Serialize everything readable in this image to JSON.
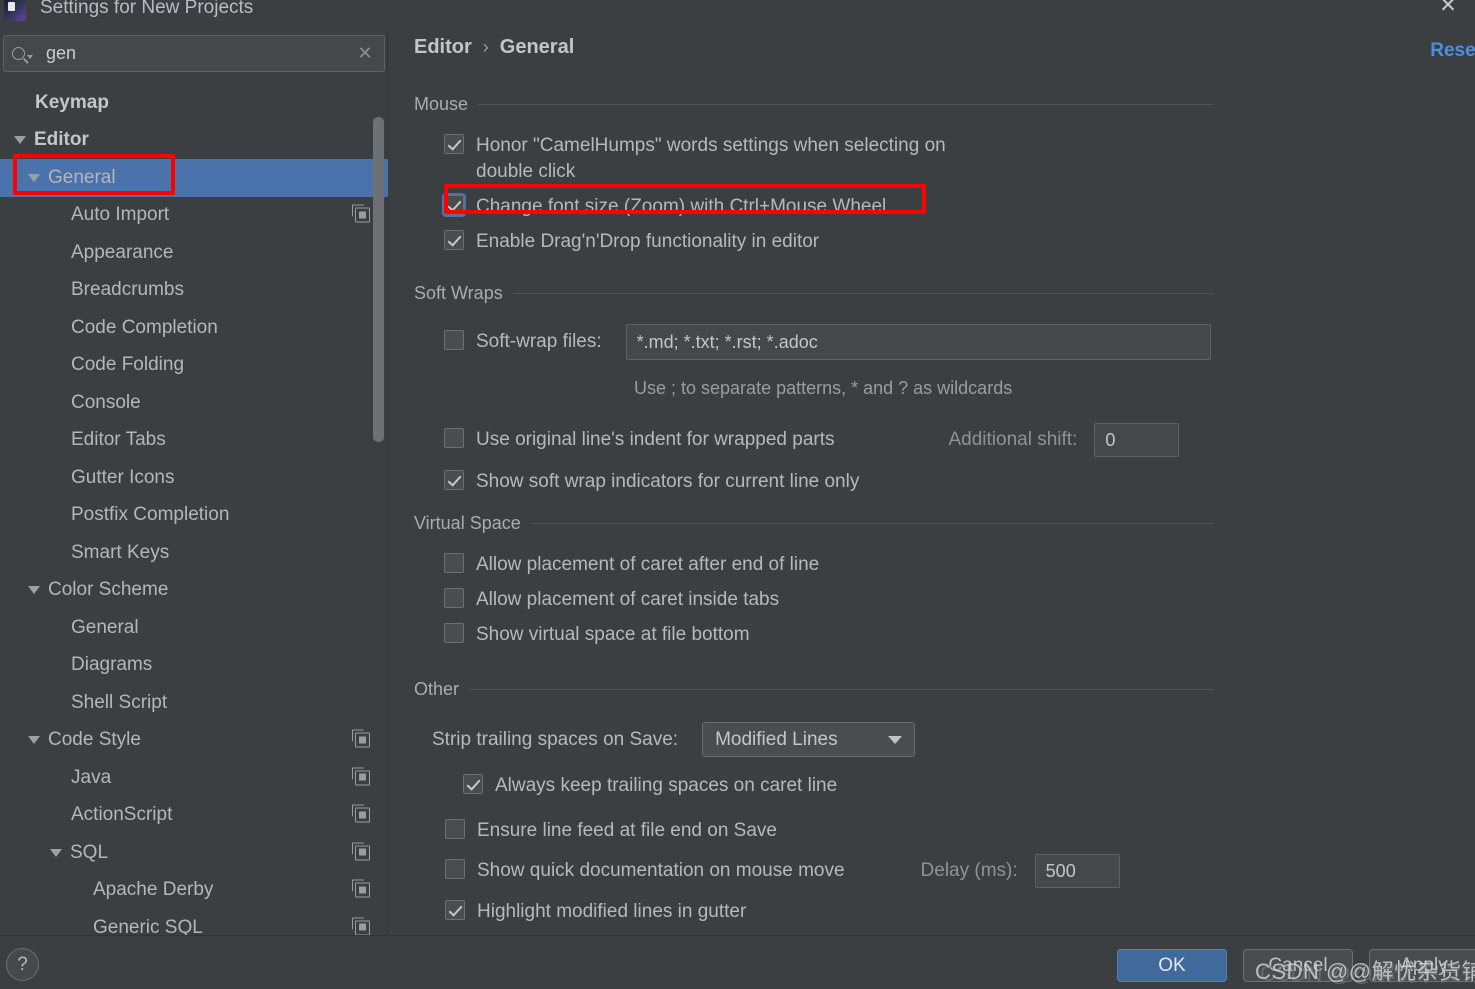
{
  "window": {
    "title": "Settings for New Projects",
    "close_icon": "close-icon",
    "app_icon": "intellij-idea-icon"
  },
  "search": {
    "value": "gen",
    "placeholder": "",
    "search_icon": "search-icon",
    "clear_icon": "clear-icon"
  },
  "sidebar": {
    "items": [
      {
        "label": "Keymap",
        "indent": 0,
        "arrow": "none",
        "bold": true,
        "selected": false,
        "copy": false
      },
      {
        "label": "Editor",
        "indent": 0,
        "arrow": "expanded",
        "bold": true,
        "selected": false,
        "copy": false
      },
      {
        "label": "General",
        "indent": 1,
        "arrow": "expanded",
        "bold": false,
        "selected": true,
        "copy": false
      },
      {
        "label": "Auto Import",
        "indent": 2,
        "arrow": "none",
        "bold": false,
        "selected": false,
        "copy": true
      },
      {
        "label": "Appearance",
        "indent": 2,
        "arrow": "none",
        "bold": false,
        "selected": false,
        "copy": false
      },
      {
        "label": "Breadcrumbs",
        "indent": 2,
        "arrow": "none",
        "bold": false,
        "selected": false,
        "copy": false
      },
      {
        "label": "Code Completion",
        "indent": 2,
        "arrow": "none",
        "bold": false,
        "selected": false,
        "copy": false
      },
      {
        "label": "Code Folding",
        "indent": 2,
        "arrow": "none",
        "bold": false,
        "selected": false,
        "copy": false
      },
      {
        "label": "Console",
        "indent": 2,
        "arrow": "none",
        "bold": false,
        "selected": false,
        "copy": false
      },
      {
        "label": "Editor Tabs",
        "indent": 2,
        "arrow": "none",
        "bold": false,
        "selected": false,
        "copy": false
      },
      {
        "label": "Gutter Icons",
        "indent": 2,
        "arrow": "none",
        "bold": false,
        "selected": false,
        "copy": false
      },
      {
        "label": "Postfix Completion",
        "indent": 2,
        "arrow": "none",
        "bold": false,
        "selected": false,
        "copy": false
      },
      {
        "label": "Smart Keys",
        "indent": 2,
        "arrow": "none",
        "bold": false,
        "selected": false,
        "copy": false
      },
      {
        "label": "Color Scheme",
        "indent": 1,
        "arrow": "expanded",
        "bold": false,
        "selected": false,
        "copy": false
      },
      {
        "label": "General",
        "indent": 2,
        "arrow": "none",
        "bold": false,
        "selected": false,
        "copy": false
      },
      {
        "label": "Diagrams",
        "indent": 2,
        "arrow": "none",
        "bold": false,
        "selected": false,
        "copy": false
      },
      {
        "label": "Shell Script",
        "indent": 2,
        "arrow": "none",
        "bold": false,
        "selected": false,
        "copy": false
      },
      {
        "label": "Code Style",
        "indent": 1,
        "arrow": "expanded",
        "bold": false,
        "selected": false,
        "copy": true
      },
      {
        "label": "Java",
        "indent": 2,
        "arrow": "none",
        "bold": false,
        "selected": false,
        "copy": true
      },
      {
        "label": "ActionScript",
        "indent": 2,
        "arrow": "none",
        "bold": false,
        "selected": false,
        "copy": true
      },
      {
        "label": "SQL",
        "indent": 2,
        "arrow": "expanded",
        "bold": false,
        "selected": false,
        "copy": true
      },
      {
        "label": "Apache Derby",
        "indent": 3,
        "arrow": "none",
        "bold": false,
        "selected": false,
        "copy": true
      },
      {
        "label": "Generic SQL",
        "indent": 3,
        "arrow": "none",
        "bold": false,
        "selected": false,
        "copy": true
      }
    ]
  },
  "main": {
    "breadcrumb": {
      "parent": "Editor",
      "separator": "›",
      "current": "General"
    },
    "reset_label": "Reset",
    "sections": {
      "mouse": {
        "title": "Mouse",
        "options": [
          {
            "label": "Honor \"CamelHumps\" words settings when selecting on double click",
            "checked": true,
            "highlighted": false
          },
          {
            "label": "Change font size (Zoom) with Ctrl+Mouse Wheel",
            "checked": true,
            "highlighted": true
          },
          {
            "label": "Enable Drag'n'Drop functionality in editor",
            "checked": true,
            "highlighted": false
          }
        ]
      },
      "soft_wraps": {
        "title": "Soft Wraps",
        "softwrap_files_label": "Soft-wrap files:",
        "softwrap_files_checked": false,
        "softwrap_files_value": "*.md; *.txt; *.rst; *.adoc",
        "hint": "Use ; to separate patterns, * and ? as wildcards",
        "use_original_indent_label": "Use original line's indent for wrapped parts",
        "use_original_indent_checked": false,
        "additional_shift_label": "Additional shift:",
        "additional_shift_value": "0",
        "show_indicators_label": "Show soft wrap indicators for current line only",
        "show_indicators_checked": true
      },
      "virtual_space": {
        "title": "Virtual Space",
        "options": [
          {
            "label": "Allow placement of caret after end of line",
            "checked": false
          },
          {
            "label": "Allow placement of caret inside tabs",
            "checked": false
          },
          {
            "label": "Show virtual space at file bottom",
            "checked": false
          }
        ]
      },
      "other": {
        "title": "Other",
        "strip_label": "Strip trailing spaces on Save:",
        "strip_value": "Modified Lines",
        "always_keep_label": "Always keep trailing spaces on caret line",
        "always_keep_checked": true,
        "ensure_linefeed_label": "Ensure line feed at file end on Save",
        "ensure_linefeed_checked": false,
        "quick_doc_label": "Show quick documentation on mouse move",
        "quick_doc_checked": false,
        "delay_label": "Delay (ms):",
        "delay_value": "500",
        "highlight_modified_label": "Highlight modified lines in gutter",
        "highlight_modified_checked": true
      }
    }
  },
  "footer": {
    "help_label": "?",
    "ok_label": "OK",
    "cancel_label": "Cancel",
    "apply_label": "Apply",
    "watermark": "CSDN @@解忧杂货铺"
  },
  "colors": {
    "background": "#3c3f41",
    "selection": "#4a72ab",
    "accent_link": "#4a90e2",
    "annotation": "#ff0000",
    "primary_button": "#41699c"
  }
}
